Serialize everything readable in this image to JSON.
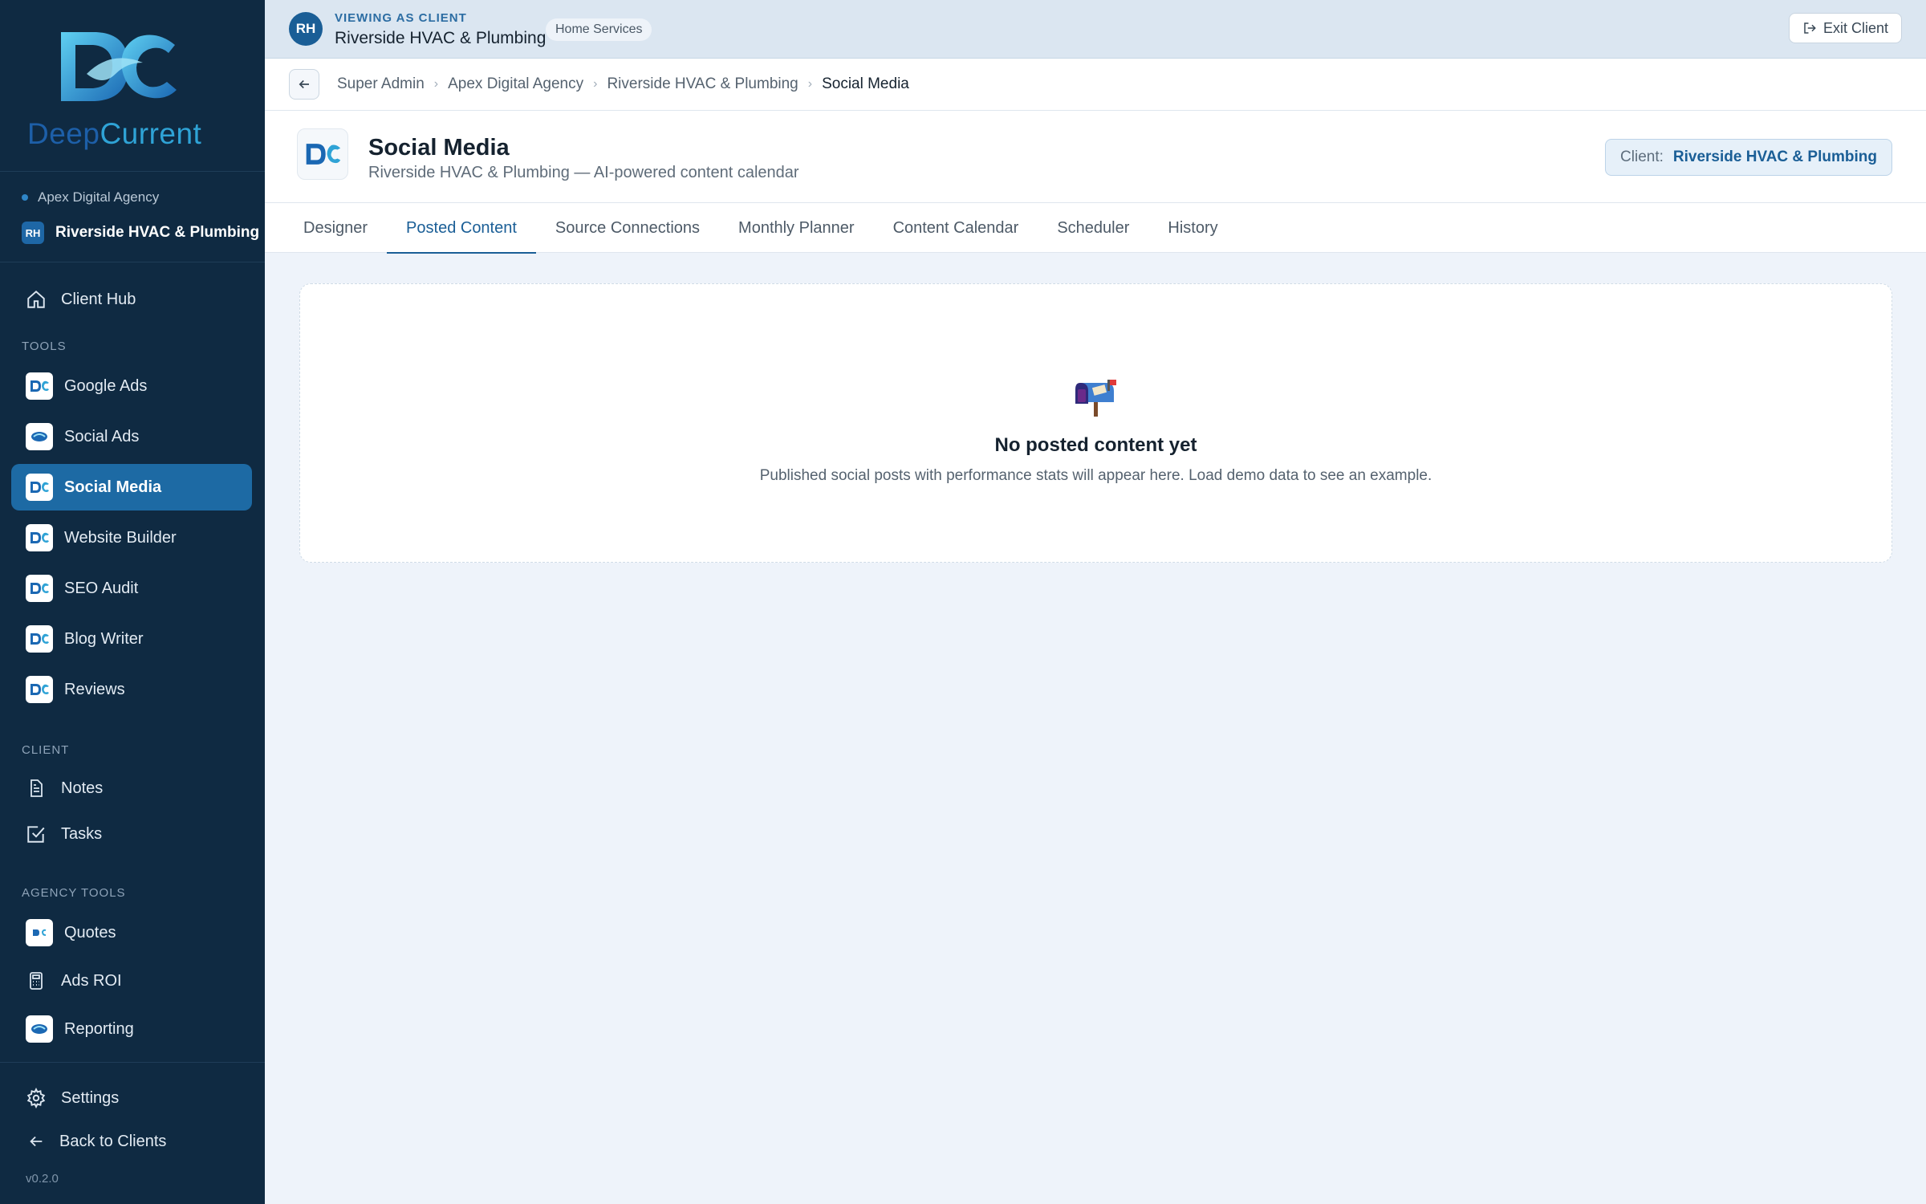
{
  "brand": {
    "word1": "Deep",
    "word2": "Current"
  },
  "sidebar": {
    "agency": "Apex Digital Agency",
    "client_initials": "RH",
    "client_name": "Riverside HVAC & Plumbing",
    "client_hub": "Client Hub",
    "tools_label": "TOOLS",
    "tools": [
      {
        "label": "Google Ads",
        "icon": "dc-logo-icon"
      },
      {
        "label": "Social Ads",
        "icon": "dc-logo-icon"
      },
      {
        "label": "Social Media",
        "icon": "dc-logo-icon",
        "active": true
      },
      {
        "label": "Website Builder",
        "icon": "dc-logo-icon"
      },
      {
        "label": "SEO Audit",
        "icon": "dc-logo-icon"
      },
      {
        "label": "Blog Writer",
        "icon": "dc-logo-icon"
      },
      {
        "label": "Reviews",
        "icon": "dc-logo-icon"
      }
    ],
    "client_label": "CLIENT",
    "client_items": [
      {
        "label": "Notes",
        "icon": "document-icon"
      },
      {
        "label": "Tasks",
        "icon": "checkbox-icon"
      }
    ],
    "agency_tools_label": "AGENCY TOOLS",
    "agency_items": [
      {
        "label": "Quotes",
        "icon": "dc-logo-icon"
      },
      {
        "label": "Ads ROI",
        "icon": "calculator-icon"
      },
      {
        "label": "Reporting",
        "icon": "dc-logo-icon"
      }
    ],
    "settings": "Settings",
    "back": "Back to Clients",
    "version": "v0.2.0"
  },
  "topbar": {
    "avatar": "RH",
    "viewing_label": "VIEWING AS CLIENT",
    "client_name": "Riverside HVAC & Plumbing",
    "tag": "Home Services",
    "exit": "Exit Client"
  },
  "breadcrumb": [
    "Super Admin",
    "Apex Digital Agency",
    "Riverside HVAC & Plumbing",
    "Social Media"
  ],
  "page": {
    "title": "Social Media",
    "subtitle": "Riverside HVAC & Plumbing — AI-powered content calendar",
    "client_label": "Client:",
    "client_value": "Riverside HVAC & Plumbing"
  },
  "tabs": [
    {
      "label": "Designer"
    },
    {
      "label": "Posted Content",
      "active": true
    },
    {
      "label": "Source Connections"
    },
    {
      "label": "Monthly Planner"
    },
    {
      "label": "Content Calendar"
    },
    {
      "label": "Scheduler"
    },
    {
      "label": "History"
    }
  ],
  "empty": {
    "icon": "mailbox-icon",
    "title": "No posted content yet",
    "description": "Published social posts with performance stats will appear here. Load demo data to see an example."
  },
  "colors": {
    "sidebar_bg": "#0f2a42",
    "accent": "#1a5e96",
    "active_nav": "#1d6aa4",
    "page_bg": "#eef3fa"
  }
}
